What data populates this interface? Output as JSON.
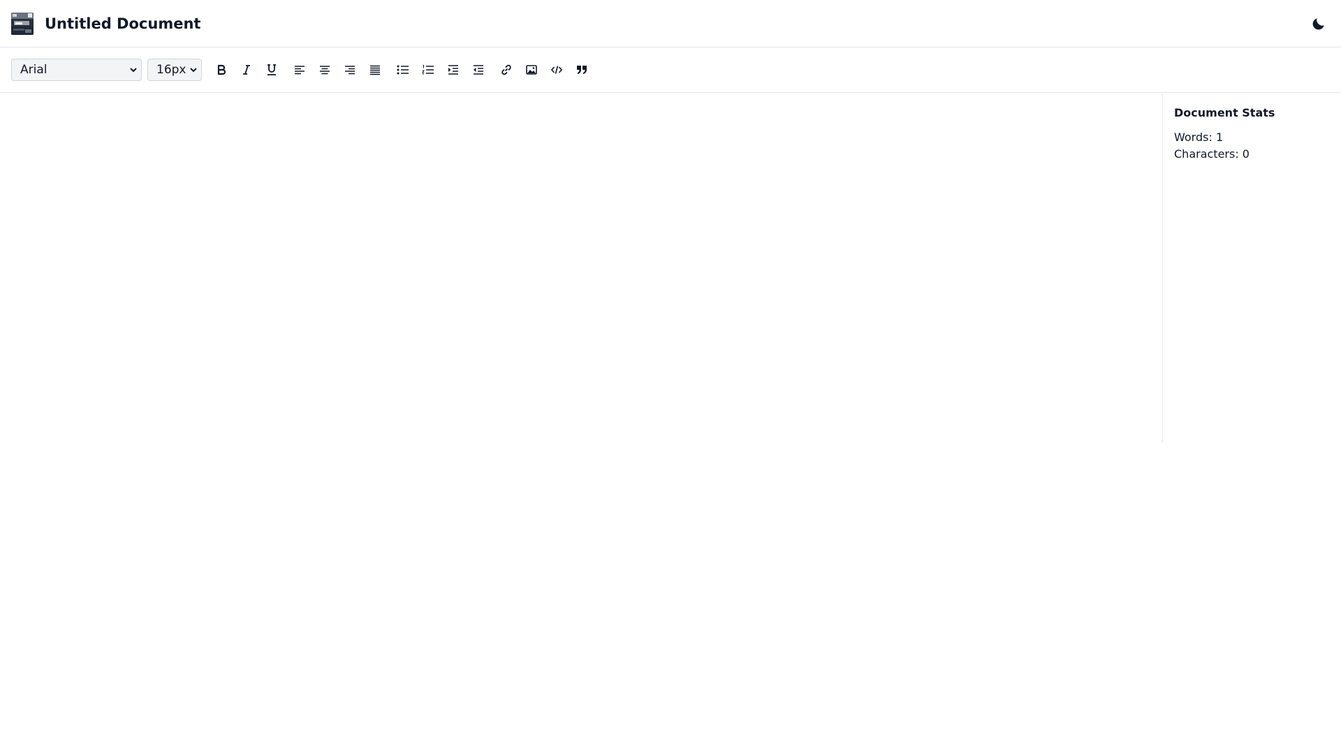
{
  "header": {
    "title": "Untitled Document",
    "logo_icon": "document-thumbnail-icon",
    "theme_toggle_icon": "moon-icon"
  },
  "toolbar": {
    "font_family": {
      "selected": "Arial"
    },
    "font_size": {
      "selected": "16px"
    },
    "buttons": [
      {
        "name": "bold",
        "icon": "bold-icon"
      },
      {
        "name": "italic",
        "icon": "italic-icon"
      },
      {
        "name": "underline",
        "icon": "underline-icon"
      },
      {
        "name": "align-left",
        "icon": "align-left-icon"
      },
      {
        "name": "align-center",
        "icon": "align-center-icon"
      },
      {
        "name": "align-right",
        "icon": "align-right-icon"
      },
      {
        "name": "align-justify",
        "icon": "align-justify-icon"
      },
      {
        "name": "bullet-list",
        "icon": "list-ul-icon"
      },
      {
        "name": "numbered-list",
        "icon": "list-ol-icon"
      },
      {
        "name": "indent",
        "icon": "indent-icon"
      },
      {
        "name": "outdent",
        "icon": "outdent-icon"
      },
      {
        "name": "link",
        "icon": "link-icon"
      },
      {
        "name": "image",
        "icon": "image-icon"
      },
      {
        "name": "code",
        "icon": "code-icon"
      },
      {
        "name": "quote",
        "icon": "quote-icon"
      }
    ]
  },
  "stats": {
    "title": "Document Stats",
    "words": "Words: 1",
    "characters": "Characters: 0"
  },
  "colors": {
    "text": "#111827",
    "border": "#e5e7eb",
    "select_bg": "#f3f4f6"
  }
}
